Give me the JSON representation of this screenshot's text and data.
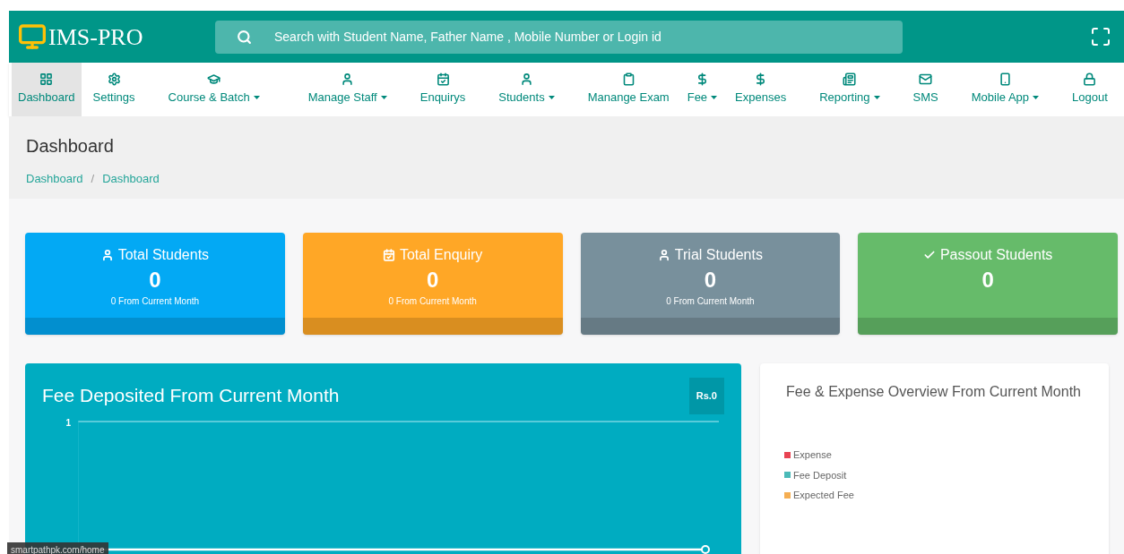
{
  "brand": "IMS-PRO",
  "search": {
    "placeholder": "Search with Student Name, Father Name , Mobile Number or Login id"
  },
  "nav": [
    {
      "label": "Dashboard",
      "selected": true,
      "dropdown": false
    },
    {
      "label": "Settings",
      "selected": false,
      "dropdown": false
    },
    {
      "label": "Course & Batch",
      "selected": false,
      "dropdown": true
    },
    {
      "label": "Manage Staff",
      "selected": false,
      "dropdown": true
    },
    {
      "label": "Enquirys",
      "selected": false,
      "dropdown": false
    },
    {
      "label": "Students",
      "selected": false,
      "dropdown": true
    },
    {
      "label": "Manange Exam",
      "selected": false,
      "dropdown": false
    },
    {
      "label": "Fee",
      "selected": false,
      "dropdown": true
    },
    {
      "label": "Expenses",
      "selected": false,
      "dropdown": false
    },
    {
      "label": "Reporting",
      "selected": false,
      "dropdown": true
    },
    {
      "label": "SMS",
      "selected": false,
      "dropdown": false
    },
    {
      "label": "Mobile App",
      "selected": false,
      "dropdown": true
    },
    {
      "label": "Logout",
      "selected": false,
      "dropdown": false
    }
  ],
  "page_title": "Dashboard",
  "breadcrumb": [
    "Dashboard",
    "Dashboard"
  ],
  "breadcrumb_separator": "/",
  "cards": [
    {
      "title": "Total Students",
      "value": "0",
      "subtitle": "0 From Current Month",
      "color": "#03a9f4"
    },
    {
      "title": "Total Enquiry",
      "value": "0",
      "subtitle": "0 From Current Month",
      "color": "#ffa726"
    },
    {
      "title": "Trial Students",
      "value": "0",
      "subtitle": "0 From Current Month",
      "color": "#78909c"
    },
    {
      "title": "Passout Students",
      "value": "0",
      "color": "#66bb6a"
    }
  ],
  "fee_panel": {
    "title": "Fee Deposited From Current Month",
    "amount": "Rs.0",
    "y_axis_label": "1"
  },
  "overview_panel": {
    "title": "Fee & Expense Overview From Current Month",
    "legend": [
      {
        "label": "Expense",
        "color": "#e84352"
      },
      {
        "label": "Fee Deposit",
        "color": "#4bbab8"
      },
      {
        "label": "Expected Fee",
        "color": "#f5ae52"
      }
    ]
  },
  "status_url": "smartpathpk.com/home"
}
